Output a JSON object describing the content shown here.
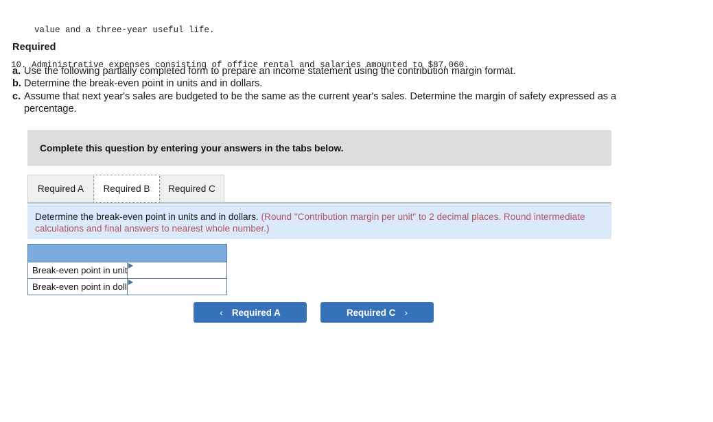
{
  "problem_lines": [
    "value and a three-year useful life.",
    "10. Administrative expenses consisting of office rental and salaries amounted to $87,060."
  ],
  "required": {
    "heading": "Required",
    "items": [
      {
        "marker": "a.",
        "text": "Use the following partially completed form to prepare an income statement using the contribution margin format."
      },
      {
        "marker": "b.",
        "text": "Determine the break-even point in units and in dollars."
      },
      {
        "marker": "c.",
        "text": "Assume that next year's sales are budgeted to be the same as the current year's sales. Determine the margin of safety expressed as a percentage."
      }
    ]
  },
  "banner": {
    "text": "Complete this question by entering your answers in the tabs below."
  },
  "tabs": [
    {
      "label": "Required A",
      "active": false
    },
    {
      "label": "Required B",
      "active": true
    },
    {
      "label": "Required C",
      "active": false
    }
  ],
  "question_band": {
    "prompt": "Determine the break-even point in units and in dollars.",
    "rounding_note": "(Round \"Contribution margin per unit\" to 2 decimal places. Round intermediate calculations and final answers to nearest whole number.)"
  },
  "answer_table": {
    "header_label": "",
    "rows": [
      {
        "label": "Break-even point in units",
        "value": "",
        "placeholder": ""
      },
      {
        "label": "Break-even point in dollars",
        "value": "",
        "placeholder": ""
      }
    ]
  },
  "navigation": {
    "prev_label": "Required A",
    "prev_icon": "chevron-left-icon",
    "prev_chevron": "‹",
    "next_label": "Required C",
    "next_icon": "chevron-right-icon",
    "next_chevron": "›"
  },
  "colors": {
    "banner_grey": "#dddddd",
    "band_blue": "#dbeafa",
    "table_header_blue": "#7cabdd",
    "button_blue": "#3572b8",
    "note_red": "#b5525c",
    "table_border": "#5c7ea1"
  }
}
